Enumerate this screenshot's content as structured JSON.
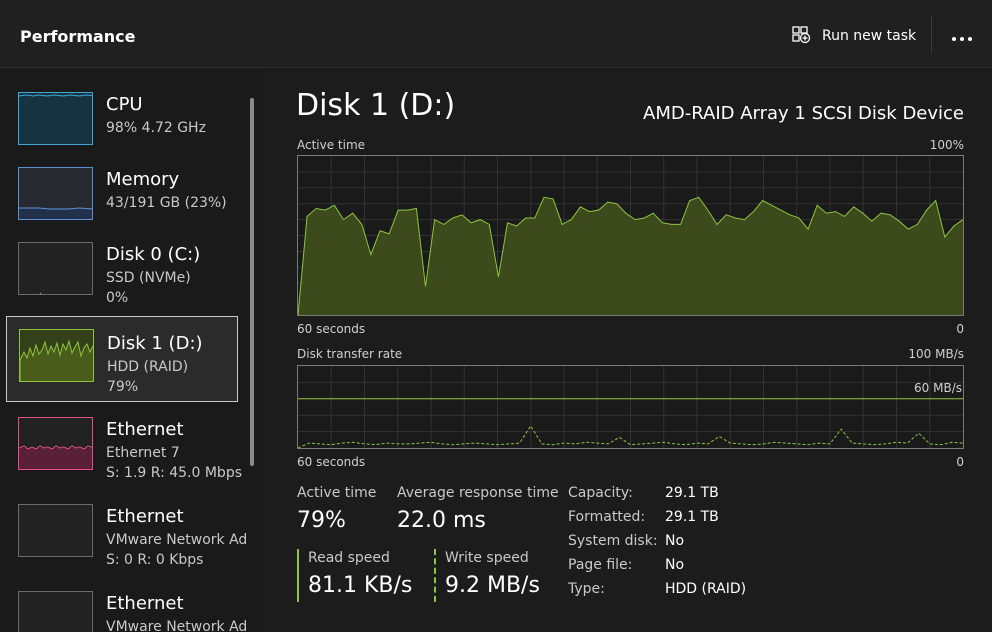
{
  "header": {
    "title": "Performance",
    "run_task_label": "Run new task"
  },
  "sidebar": {
    "items": [
      {
        "name": "CPU",
        "line1": "98% 4.72 GHz",
        "line2": ""
      },
      {
        "name": "Memory",
        "line1": "43/191 GB (23%)",
        "line2": ""
      },
      {
        "name": "Disk 0 (C:)",
        "line1": "SSD (NVMe)",
        "line2": "0%"
      },
      {
        "name": "Disk 1 (D:)",
        "line1": "HDD (RAID)",
        "line2": "79%"
      },
      {
        "name": "Ethernet",
        "line1": "Ethernet 7",
        "line2": "S: 1.9 R: 45.0 Mbps"
      },
      {
        "name": "Ethernet",
        "line1": "VMware Network Ad",
        "line2": "S: 0 R: 0 Kbps"
      },
      {
        "name": "Ethernet",
        "line1": "VMware Network Ad",
        "line2": ""
      }
    ]
  },
  "main": {
    "title": "Disk 1 (D:)",
    "model": "AMD-RAID Array 1  SCSI Disk Device",
    "active_graph": {
      "label": "Active time",
      "max_label": "100%",
      "time_label": "60 seconds",
      "min_label": "0"
    },
    "transfer_graph": {
      "label": "Disk transfer rate",
      "max_label": "100 MB/s",
      "line_label": "60 MB/s",
      "time_label": "60 seconds",
      "min_label": "0"
    },
    "stats": {
      "active_time_label": "Active time",
      "active_time_value": "79%",
      "avg_response_label": "Average response time",
      "avg_response_value": "22.0 ms",
      "read_label": "Read speed",
      "read_value": "81.1 KB/s",
      "write_label": "Write speed",
      "write_value": "9.2 MB/s"
    },
    "details": [
      {
        "key": "Capacity:",
        "value": "29.1 TB"
      },
      {
        "key": "Formatted:",
        "value": "29.1 TB"
      },
      {
        "key": "System disk:",
        "value": "No"
      },
      {
        "key": "Page file:",
        "value": "No"
      },
      {
        "key": "Type:",
        "value": "HDD (RAID)"
      }
    ]
  },
  "colors": {
    "disk_accent": "#8cc63f",
    "disk_fill": "#3c4a1c",
    "cpu_accent": "#41a5d9",
    "memory_accent": "#5d8fd6",
    "ethernet_accent": "#e04f8a"
  },
  "chart_data": [
    {
      "type": "area",
      "title": "Active time",
      "ylim": [
        0,
        100
      ],
      "values": [
        0,
        62,
        67,
        66,
        69,
        60,
        64,
        57,
        38,
        53,
        51,
        66,
        66,
        67,
        18,
        60,
        57,
        61,
        63,
        58,
        60,
        57,
        24,
        58,
        56,
        61,
        61,
        74,
        73,
        57,
        60,
        68,
        65,
        66,
        71,
        70,
        64,
        60,
        61,
        64,
        58,
        57,
        57,
        72,
        74,
        66,
        57,
        63,
        61,
        60,
        65,
        72,
        69,
        66,
        63,
        61,
        54,
        69,
        64,
        65,
        62,
        68,
        64,
        59,
        64,
        63,
        59,
        54,
        57,
        66,
        72,
        49,
        56,
        60
      ]
    },
    {
      "type": "line",
      "title": "Disk transfer rate",
      "ylim": [
        0,
        100
      ],
      "series": [
        {
          "name": "Read",
          "values": [
            0,
            6,
            5,
            4,
            6,
            7,
            5,
            4,
            6,
            5,
            5,
            6,
            7,
            5,
            4,
            5,
            6,
            5,
            4,
            5,
            6,
            27,
            5,
            4,
            6,
            5,
            7,
            6,
            5,
            13,
            4,
            5,
            6,
            7,
            5,
            4,
            6,
            5,
            14,
            6,
            5,
            4,
            5,
            7,
            6,
            5,
            4,
            6,
            5,
            23,
            6,
            5,
            4,
            5,
            7,
            6,
            18,
            5,
            4,
            7,
            6
          ]
        },
        {
          "name": "Write",
          "values": [
            60,
            60,
            60,
            60,
            60,
            60,
            60,
            60,
            60,
            60,
            60,
            60,
            60,
            60,
            60,
            60,
            60,
            60,
            60,
            60,
            60,
            60,
            60,
            60,
            60,
            60,
            60,
            60,
            60,
            60,
            60,
            60,
            60,
            60,
            60,
            60,
            60,
            60,
            60,
            60,
            60,
            60,
            60,
            60,
            60,
            60,
            60,
            60,
            60,
            60,
            60,
            60,
            60,
            60,
            60,
            60,
            60,
            60,
            60,
            60,
            60
          ]
        }
      ]
    }
  ]
}
